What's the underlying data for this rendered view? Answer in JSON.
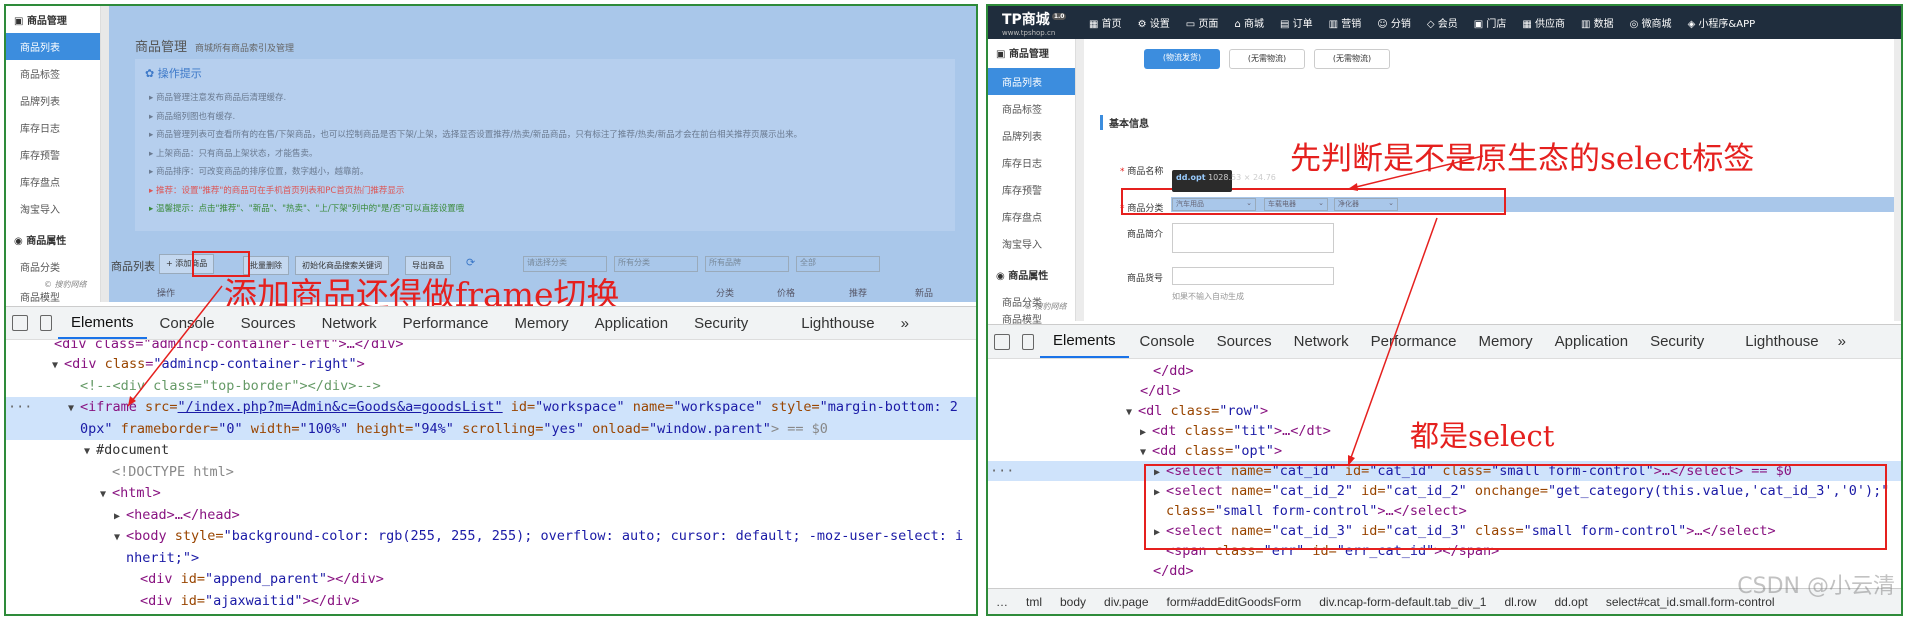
{
  "left": {
    "sidebar": {
      "group1": "商品管理",
      "items": [
        "商品列表",
        "商品标签",
        "品牌列表",
        "库存日志",
        "库存预警",
        "库存盘点",
        "淘宝导入"
      ],
      "group2": "商品属性",
      "items2": [
        "商品分类",
        "商品模型"
      ],
      "logo": "© 搜豹网络"
    },
    "page": {
      "title": "商品管理",
      "subtitle": "商城所有商品索引及管理",
      "tips_title": "操作提示",
      "tips": [
        "商品管理注意发布商品后清理缓存.",
        "商品缩列图也有缓存.",
        "商品管理列表可查看所有的在售/下架商品，也可以控制商品是否下架/上架，选择显否设置推荐/热卖/新品商品，只有标注了推荐/热卖/新品才会在前台相关推荐页展示出来。",
        "上架商品：只有商品上架状态，才能售卖。",
        "商品排序：可改变商品的排序位置，数字越小，越靠前。",
        "推荐：设置\"推荐\"的商品可在手机首页列表和PC首页热门推荐显示",
        "温馨提示：点击\"推荐\"、\"新品\"、\"热卖\"、\"上/下架\"列中的\"是/否\"可以直接设置哦"
      ],
      "list_title": "商品列表",
      "add_btn": "+ 添加商品",
      "batch_del": "批量删除",
      "init_btn": "初始化商品搜索关键词",
      "export_btn": "导出商品",
      "sel1": "请选择分类",
      "sel2": "所有分类",
      "sel3": "所有品牌",
      "sel4": "全部",
      "col_a": "操作",
      "col_b": "分类",
      "col_c": "价格",
      "col_d": "推荐",
      "col_e": "新品"
    },
    "devtools": {
      "tabs": [
        "Elements",
        "Console",
        "Sources",
        "Network",
        "Performance",
        "Memory",
        "Application",
        "Security",
        "Lighthouse"
      ],
      "more": "»"
    },
    "annotation": "添加商品还得做frame切换",
    "code": {
      "l0": "<div class=\"admincp-container-left\">…</div>",
      "l1a": "<div ",
      "l1b": "class",
      "l1c": "\"admincp-container-right\"",
      "l2": "<!--<div class=\"top-border\"></div>-->",
      "l3a": "<iframe ",
      "l3b": "src=",
      "l3c": "\"/index.php?m=Admin&c=Goods&a=goodsList\"",
      "l3d": " id=",
      "l3e": "\"workspace\"",
      "l3f": " name=",
      "l3g": "\"workspace\"",
      "l3h": " style=",
      "l3i": "\"margin-bottom: 2",
      "l4a": "0px\"",
      "l4b": " frameborder=",
      "l4c": "\"0\"",
      "l4d": " width=",
      "l4e": "\"100%\"",
      "l4f": " height=",
      "l4g": "\"94%\"",
      "l4h": " scrolling=",
      "l4i": "\"yes\"",
      "l4j": " onload=",
      "l4k": "\"window.parent\"",
      "l4l": "> == $0",
      "l5": "#document",
      "l6": "<!DOCTYPE html>",
      "l7": "<html>",
      "l8": "<head>…</head>",
      "l9a": "<body ",
      "l9b": "style=",
      "l9c": "\"background-color: rgb(255, 255, 255); overflow: auto; cursor: default; -moz-user-select: i",
      "l10": "nherit;\">",
      "l11a": "<div ",
      "l11b": "id=",
      "l11c": "\"append_parent\"",
      "l11d": "></div>",
      "l12a": "<div ",
      "l12b": "id=",
      "l12c": "\"ajaxwaitid\"",
      "l12d": "></div>"
    }
  },
  "right": {
    "brand": "TP商城",
    "brand_url": "www.tpshop.cn",
    "brand_badge": "1.0",
    "nav": [
      "首页",
      "设置",
      "页面",
      "商城",
      "订单",
      "营销",
      "分销",
      "会员",
      "门店",
      "供应商",
      "数据",
      "微商城",
      "小程序&APP"
    ],
    "sidebar": {
      "group1": "商品管理",
      "items": [
        "商品列表",
        "商品标签",
        "品牌列表",
        "库存日志",
        "库存预警",
        "库存盘点",
        "淘宝导入"
      ],
      "group2": "商品属性",
      "items2": [
        "商品分类",
        "商品模型"
      ],
      "logo": "© 搜豹网络"
    },
    "form": {
      "btn1": "(物流发货)",
      "btn2": "(无需物流)",
      "btn3": "(无需物流)",
      "section": "基本信息",
      "f_name": "商品名称",
      "f_cat": "商品分类",
      "f_desc": "商品简介",
      "f_sn": "商品货号",
      "sn_hint": "如果不输入自动生成",
      "cat1": "汽车用品",
      "cat2": "车载电器",
      "cat3": "净化器",
      "tooltip_tag": "dd.opt",
      "tooltip_size": "1028.53 × 24.76"
    },
    "annotation1": "先判断是不是原生态的select标签",
    "annotation2": "都是select",
    "devtools": {
      "tabs": [
        "Elements",
        "Console",
        "Sources",
        "Network",
        "Performance",
        "Memory",
        "Application",
        "Security",
        "Lighthouse"
      ],
      "more": "»"
    },
    "code": {
      "l0": "</dd>",
      "l1": "</dl>",
      "l2a": "<dl ",
      "l2b": "class=",
      "l2c": "\"row\"",
      "l2d": ">",
      "l3a": "<dt ",
      "l3b": "class=",
      "l3c": "\"tit\"",
      "l3d": ">…</dt>",
      "l4a": "<dd ",
      "l4b": "class=",
      "l4c": "\"opt\"",
      "l4d": ">",
      "l5a": "<select ",
      "l5b": "name=",
      "l5c": "\"cat_id\"",
      "l5d": " id=",
      "l5e": "\"cat_id\"",
      "l5f": " class=",
      "l5g": "\"small form-control\"",
      "l5h": ">…</select> == $0",
      "l6a": "<select ",
      "l6b": "name=",
      "l6c": "\"cat_id_2\"",
      "l6d": " id=",
      "l6e": "\"cat_id_2\"",
      "l6f": " onchange=",
      "l6g": "\"get_category(this.value,'cat_id_3','0');\"",
      "l7a": "class=",
      "l7b": "\"small form-control\"",
      "l7c": ">…</select>",
      "l8a": "<select ",
      "l8b": "name=",
      "l8c": "\"cat_id_3\"",
      "l8d": " id=",
      "l8e": "\"cat_id_3\"",
      "l8f": " class=",
      "l8g": "\"small form-control\"",
      "l8h": ">…</select>",
      "l9a": "<span ",
      "l9b": "class=",
      "l9c": "\"err\"",
      "l9d": " id=",
      "l9e": "\"err_cat_id\"",
      "l9f": "></span>",
      "l10": "</dd>"
    },
    "breadcrumb": [
      "…",
      "tml",
      "body",
      "div.page",
      "form#addEditGoodsForm",
      "div.ncap-form-default.tab_div_1",
      "dl.row",
      "dd.opt",
      "select#cat_id.small.form-control"
    ],
    "watermark": "CSDN @小云清"
  },
  "colors": {
    "accent": "#3c8dde",
    "annotation": "#e5201e",
    "frame": "#2e8b3a"
  }
}
